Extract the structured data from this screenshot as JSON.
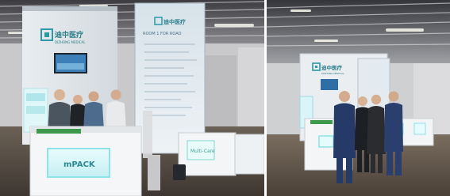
{
  "photos": [
    {
      "id": "left",
      "brand_cn": "迪中医疗",
      "brand_en": "DIZHONG MEDICAL",
      "counter_logo": "mPACK",
      "panel_heading": "ROOM 1 FOR ROAD",
      "side_counter_logo": "Multi-Care"
    },
    {
      "id": "right",
      "brand_cn": "迪中医疗",
      "brand_en": "DIZHONG MEDICAL"
    }
  ]
}
